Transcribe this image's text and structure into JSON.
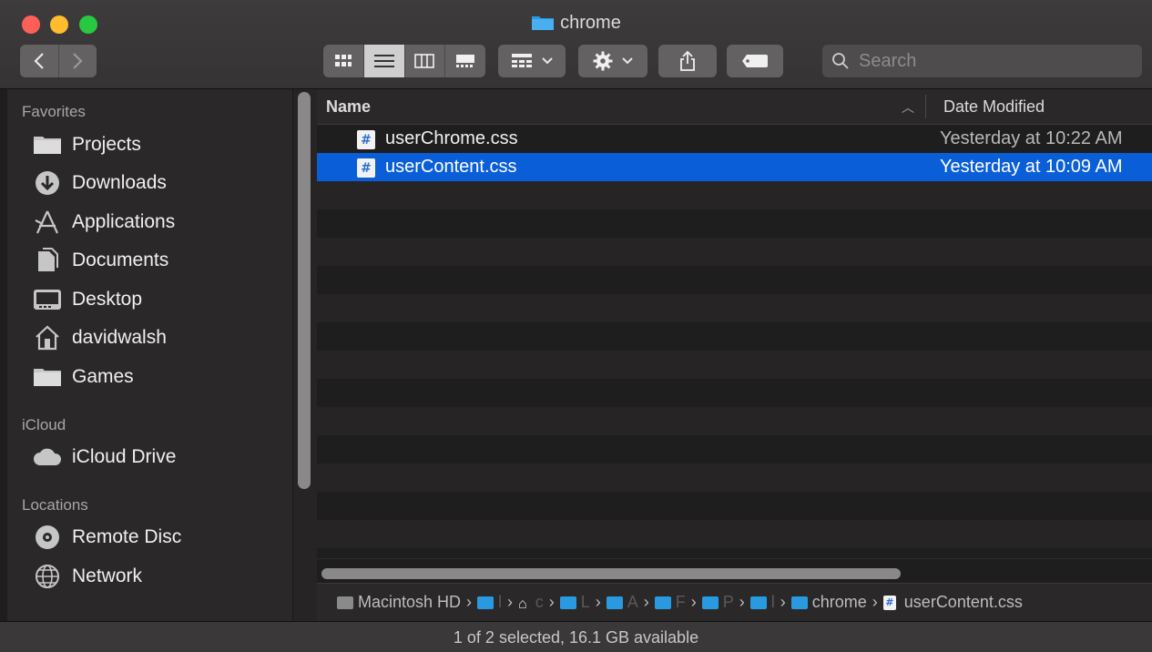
{
  "window": {
    "title": "chrome"
  },
  "toolbar": {
    "back_icon": "chevron-left",
    "forward_icon": "chevron-right",
    "view_modes": [
      "icon-view",
      "list-view",
      "column-view",
      "gallery-view"
    ],
    "active_view": "list-view",
    "group_icon": "group-by",
    "action_icon": "gear",
    "share_icon": "share",
    "tag_icon": "tag",
    "search_placeholder": "Search"
  },
  "sidebar": {
    "sections": [
      {
        "title": "Favorites",
        "items": [
          {
            "label": "Projects",
            "icon": "folder"
          },
          {
            "label": "Downloads",
            "icon": "download"
          },
          {
            "label": "Applications",
            "icon": "applications"
          },
          {
            "label": "Documents",
            "icon": "document"
          },
          {
            "label": "Desktop",
            "icon": "desktop"
          },
          {
            "label": "davidwalsh",
            "icon": "home"
          },
          {
            "label": "Games",
            "icon": "folder"
          }
        ]
      },
      {
        "title": "iCloud",
        "items": [
          {
            "label": "iCloud Drive",
            "icon": "cloud"
          }
        ]
      },
      {
        "title": "Locations",
        "items": [
          {
            "label": "Remote Disc",
            "icon": "disc"
          },
          {
            "label": "Network",
            "icon": "network"
          }
        ]
      }
    ]
  },
  "list": {
    "columns": {
      "name": "Name",
      "date": "Date Modified"
    },
    "files": [
      {
        "name": "userChrome.css",
        "date": "Yesterday at 10:22 AM",
        "selected": false
      },
      {
        "name": "userContent.css",
        "date": "Yesterday at 10:09 AM",
        "selected": true
      }
    ]
  },
  "pathbar": {
    "items": [
      {
        "label": "Macintosh HD",
        "icon": "hd"
      },
      {
        "label": "l",
        "icon": "folder-user",
        "dim": true
      },
      {
        "label": "c",
        "icon": "home",
        "dim": true
      },
      {
        "label": "L",
        "icon": "folder-library",
        "dim": true
      },
      {
        "label": "A",
        "icon": "folder",
        "dim": true
      },
      {
        "label": "F",
        "icon": "folder",
        "dim": true
      },
      {
        "label": "P",
        "icon": "folder",
        "dim": true
      },
      {
        "label": "l",
        "icon": "folder",
        "dim": true
      },
      {
        "label": "chrome",
        "icon": "folder"
      },
      {
        "label": "userContent.css",
        "icon": "css-file"
      }
    ]
  },
  "statusbar": {
    "text": "1 of 2 selected, 16.1 GB available"
  },
  "colors": {
    "selection": "#0a5fd8",
    "folder": "#2a9ae0"
  }
}
